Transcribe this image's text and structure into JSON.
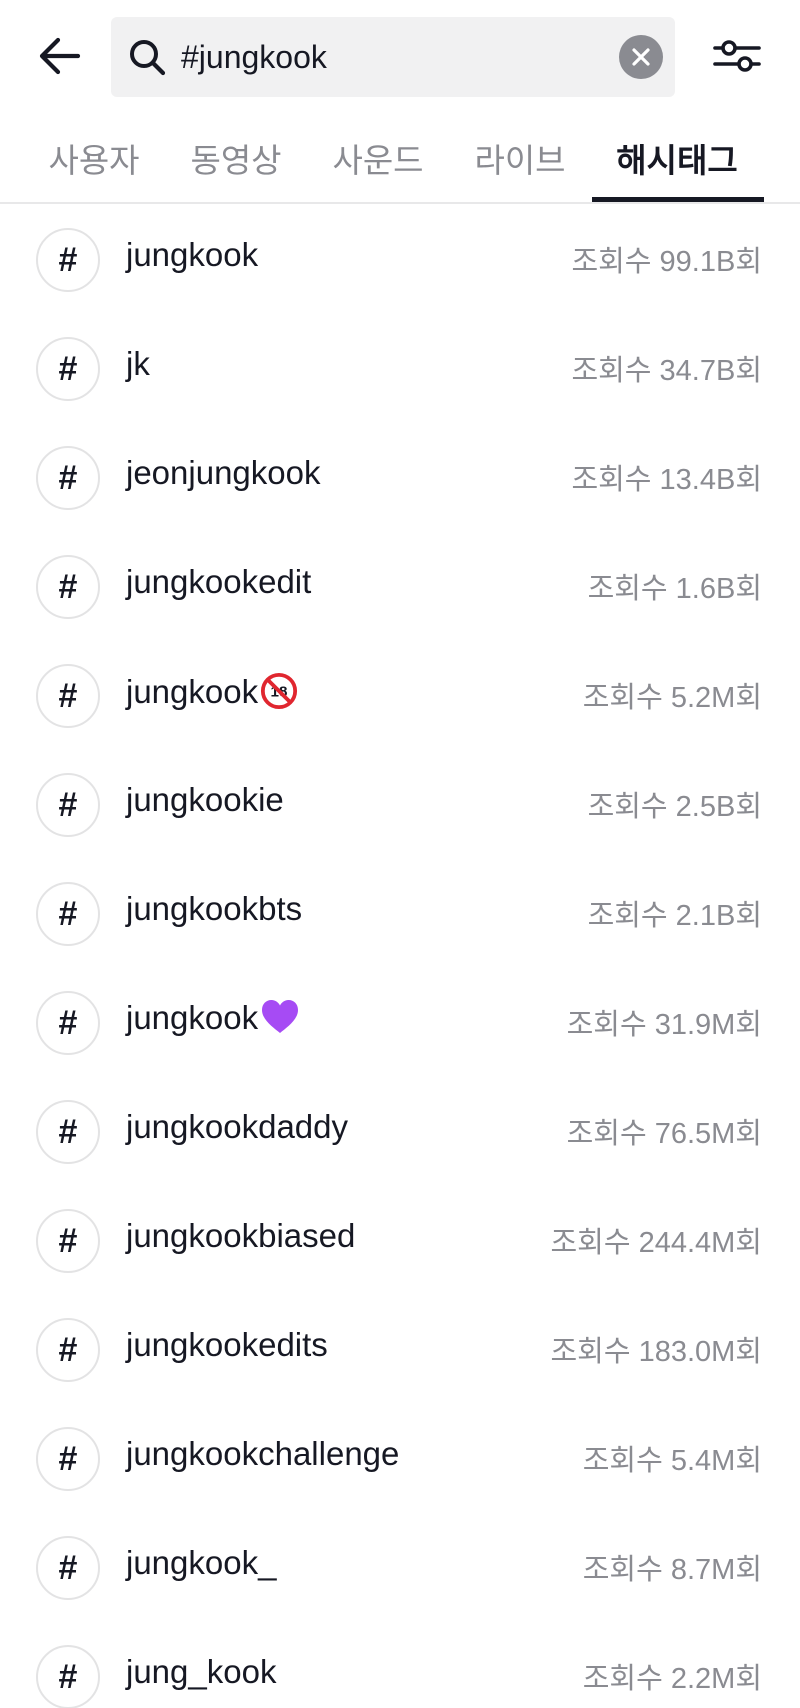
{
  "header": {
    "search_value": "#jungkook"
  },
  "tabs": [
    {
      "label": "사용자",
      "active": false
    },
    {
      "label": "동영상",
      "active": false
    },
    {
      "label": "사운드",
      "active": false
    },
    {
      "label": "라이브",
      "active": false
    },
    {
      "label": "해시태그",
      "active": true
    }
  ],
  "hashtags": [
    {
      "symbol": "#",
      "name": "jungkook",
      "views": "조회수 99.1B회"
    },
    {
      "symbol": "#",
      "name": "jk",
      "views": "조회수 34.7B회"
    },
    {
      "symbol": "#",
      "name": "jeonjungkook",
      "views": "조회수 13.4B회"
    },
    {
      "symbol": "#",
      "name": "jungkookedit",
      "views": "조회수 1.6B회"
    },
    {
      "symbol": "#",
      "name": "jungkook",
      "emoji": "no-one-under-eighteen-icon",
      "views": "조회수 5.2M회"
    },
    {
      "symbol": "#",
      "name": "jungkookie",
      "views": "조회수 2.5B회"
    },
    {
      "symbol": "#",
      "name": "jungkookbts",
      "views": "조회수 2.1B회"
    },
    {
      "symbol": "#",
      "name": "jungkook",
      "emoji": "purple-heart-icon",
      "views": "조회수 31.9M회"
    },
    {
      "symbol": "#",
      "name": "jungkookdaddy",
      "views": "조회수 76.5M회"
    },
    {
      "symbol": "#",
      "name": "jungkookbiased",
      "views": "조회수 244.4M회"
    },
    {
      "symbol": "#",
      "name": "jungkookedits",
      "views": "조회수 183.0M회"
    },
    {
      "symbol": "#",
      "name": "jungkookchallenge",
      "views": "조회수 5.4M회"
    },
    {
      "symbol": "#",
      "name": "jungkook_",
      "views": "조회수 8.7M회"
    },
    {
      "symbol": "#",
      "name": "jung_kook",
      "views": "조회수 2.2M회"
    }
  ],
  "colors": {
    "text_primary": "#161823",
    "text_secondary": "#8a8b91",
    "search_bg": "#f1f1f2",
    "divider": "#e8e8e9",
    "heart": "#a64bf4",
    "prohibited": "#e0262f"
  }
}
